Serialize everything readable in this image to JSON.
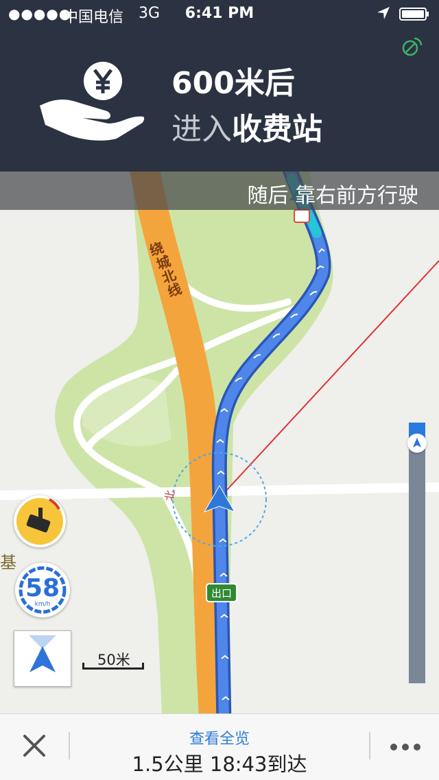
{
  "status_bar": {
    "signal_dots": "●●●●●",
    "carrier": "中国电信",
    "network": "3G",
    "time": "6:41 PM"
  },
  "guidance": {
    "distance": "600米后",
    "action_prefix": "进入",
    "action_name": "收费站",
    "next_instruction": "随后 靠右前方行驶",
    "turn_icon": "toll-yuan-hand-icon"
  },
  "map": {
    "road_label": "绕城北线",
    "road_label_chars": [
      "绕",
      "城",
      "北",
      "线"
    ],
    "place_label": "基",
    "exit_sign": "出口",
    "north_marker": "北",
    "scale_label": "50米",
    "colors": {
      "route": "#3d72e0",
      "highway": "#f4a43c",
      "green_area": "#cde4a6",
      "header": "#2b3241"
    }
  },
  "controls": {
    "speed_limit": "58",
    "speed_unit": "km/h",
    "camera_icon": "traffic-camera-icon",
    "compass_icon": "north-arrow-icon",
    "route_progress": 0.04
  },
  "bottom_bar": {
    "overview_label": "查看全览",
    "trip_summary": "1.5公里 18:43到达",
    "close_icon": "close-icon",
    "more_icon": "more-icon"
  }
}
